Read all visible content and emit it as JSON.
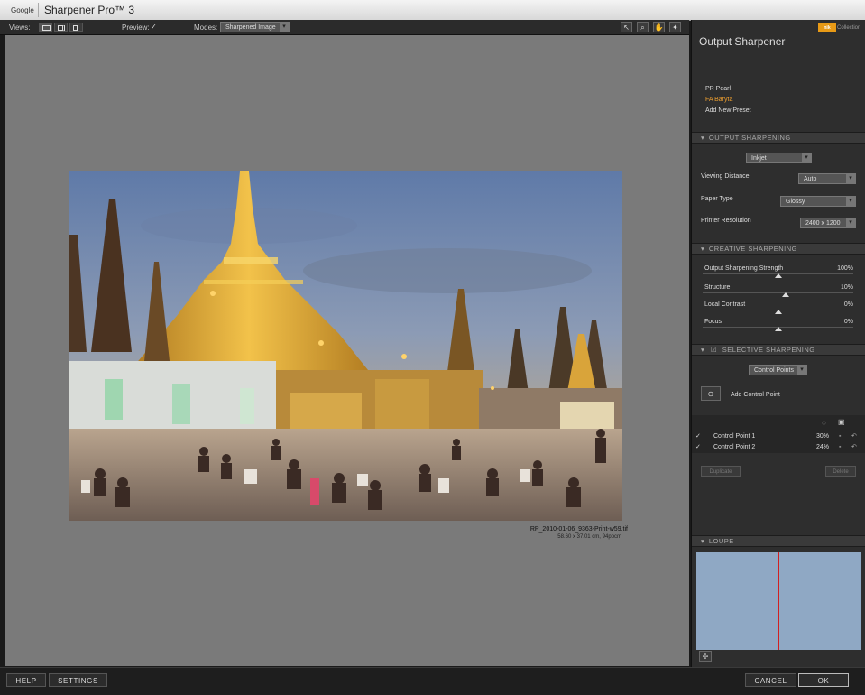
{
  "titlebar": {
    "brand": "Google",
    "app_title": "Sharpener Pro™ 3"
  },
  "toolbar": {
    "views_label": "Views:",
    "preview_label": "Preview:",
    "preview_checked": "✓",
    "modes_label": "Modes:",
    "modes_value": "Sharpened Image"
  },
  "image": {
    "filename": "RP_2010-01-06_9363-Print-w59.tif",
    "dimensions": "58.60 x 37.01 cm, 94ppcm"
  },
  "panel": {
    "title": "Output Sharpener",
    "collection_label": "Collection",
    "nik_logo": "nik",
    "presets": [
      "PR Pearl",
      "FA Baryta",
      "Add New Preset"
    ],
    "output_sharpening": {
      "header": "OUTPUT SHARPENING",
      "device": "Inkjet",
      "viewing_distance_label": "Viewing Distance",
      "viewing_distance_value": "Auto",
      "paper_type_label": "Paper Type",
      "paper_type_value": "Glossy",
      "printer_resolution_label": "Printer Resolution",
      "printer_resolution_value": "2400 x 1200"
    },
    "creative_sharpening": {
      "header": "CREATIVE SHARPENING",
      "sliders": [
        {
          "label": "Output Sharpening Strength",
          "value": "100%",
          "level": 0.5
        },
        {
          "label": "Structure",
          "value": "10%",
          "level": 0.55
        },
        {
          "label": "Local Contrast",
          "value": "0%",
          "level": 0.5
        },
        {
          "label": "Focus",
          "value": "0%",
          "level": 0.5
        }
      ]
    },
    "selective_sharpening": {
      "header": "SELECTIVE SHARPENING",
      "mode": "Control Points",
      "add_label": "Add Control Point",
      "control_points": [
        {
          "name": "Control Point 1",
          "value": "30%"
        },
        {
          "name": "Control Point 2",
          "value": "24%"
        }
      ],
      "duplicate_label": "Duplicate",
      "delete_label": "Delete"
    },
    "loupe": {
      "header": "LOUPE"
    }
  },
  "footer": {
    "help": "HELP",
    "settings": "SETTINGS",
    "cancel": "CANCEL",
    "ok": "OK"
  },
  "colors": {
    "accent_orange": "#e89a16",
    "preset_active": "#f0a030",
    "loupe_line": "#d02020"
  }
}
